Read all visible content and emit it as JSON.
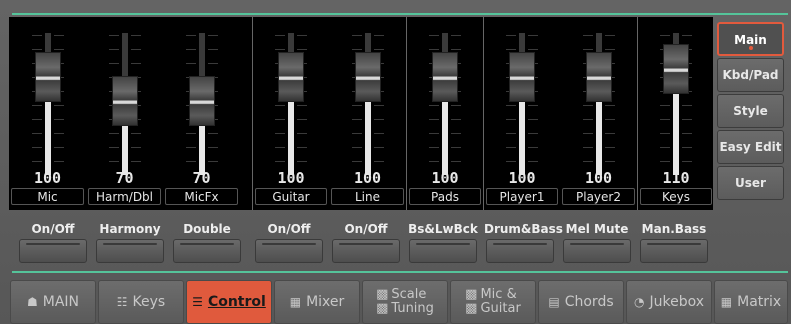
{
  "mixer": {
    "channels": [
      {
        "name": "Mic",
        "value": "100",
        "level": 100
      },
      {
        "name": "Harm/Dbl",
        "value": "70",
        "level": 70
      },
      {
        "name": "MicFx",
        "value": "70",
        "level": 70
      },
      {
        "name": "Guitar",
        "value": "100",
        "level": 100
      },
      {
        "name": "Line",
        "value": "100",
        "level": 100
      },
      {
        "name": "Pads",
        "value": "100",
        "level": 100
      },
      {
        "name": "Player1",
        "value": "100",
        "level": 100
      },
      {
        "name": "Player2",
        "value": "100",
        "level": 100
      },
      {
        "name": "Keys",
        "value": "110",
        "level": 110
      }
    ]
  },
  "side_tabs": [
    "Main",
    "Kbd/Pad",
    "Style",
    "Easy Edit",
    "User"
  ],
  "side_active": "Main",
  "controls": [
    "On/Off",
    "Harmony",
    "Double",
    "On/Off",
    "On/Off",
    "Bs&LwBck",
    "Drum&Bass",
    "Mel Mute",
    "Man.Bass"
  ],
  "nav": {
    "main": "MAIN",
    "keys": "Keys",
    "control": "Control",
    "mixer": "Mixer",
    "scale_1": "Scale",
    "scale_2": "Tuning",
    "mic_1": "Mic &",
    "mic_2": "Guitar",
    "chords": "Chords",
    "jukebox": "Jukebox",
    "matrix": "Matrix"
  },
  "colors": {
    "accent": "#e05a3d",
    "line": "#55c49a"
  }
}
